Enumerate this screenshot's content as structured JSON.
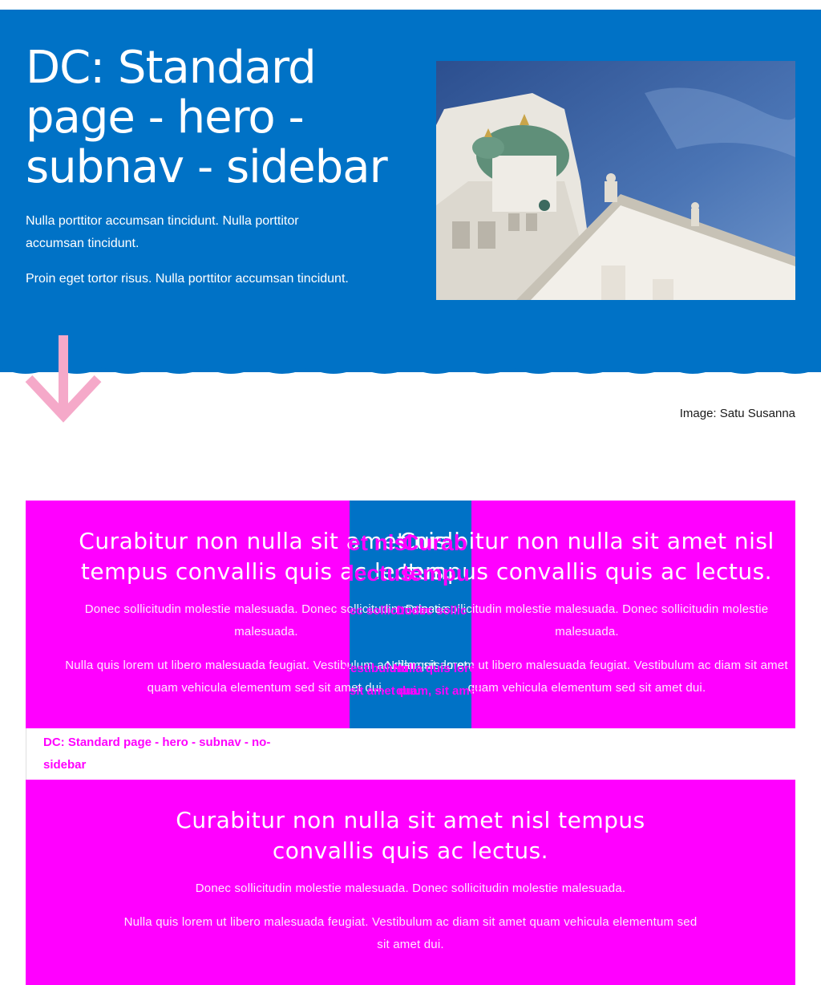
{
  "hero": {
    "title": "DC: Standard page - hero - subnav - sidebar",
    "paragraphs": [
      "Nulla porttitor accumsan tincidunt. Nulla porttitor accumsan tincidunt.",
      "Proin eget tortor risus. Nulla porttitor accumsan tincidunt."
    ],
    "image_caption": "Image: Satu Susanna",
    "background_color": "#0072c6"
  },
  "content_top": {
    "heading": "Curabitur non nulla sit amet nisl tempus convallis quis ac lectus.",
    "paragraphs": [
      "Donec sollicitudin molestie malesuada. Donec sollicitudin molestie malesuada.",
      "Nulla quis lorem ut libero malesuada feugiat. Vestibulum ac diam sit amet quam vehicula elementum sed sit amet dui."
    ],
    "overlaps": {
      "heading_a": "et nisl",
      "heading_b": "lectus.",
      "heading_c": "Curab",
      "heading_d": "tempu",
      "p1_a": "ec sollicitudin",
      "p1_b": "Donec sollic",
      "p2_a": "Vestibulum",
      "p2_b": "Nulla quis lore",
      "p2_c": "sit amet dui.",
      "p2_d": "quam, sit amet"
    }
  },
  "subnav": {
    "link": "DC: Standard page - hero - subnav - no-sidebar"
  },
  "content_bottom": {
    "heading": "Curabitur non nulla sit amet nisl tempus convallis quis ac lectus.",
    "paragraphs": [
      "Donec sollicitudin molestie malesuada. Donec sollicitudin molestie malesuada.",
      "Nulla quis lorem ut libero malesuada feugiat. Vestibulum ac diam sit amet quam vehicula elementum sed sit amet dui."
    ]
  },
  "colors": {
    "brand_blue": "#0072c6",
    "debug_magenta": "#ff00ff",
    "arrow_pink": "#f5a9c9"
  },
  "icons": {
    "scroll_arrow": "arrow-down-icon"
  }
}
